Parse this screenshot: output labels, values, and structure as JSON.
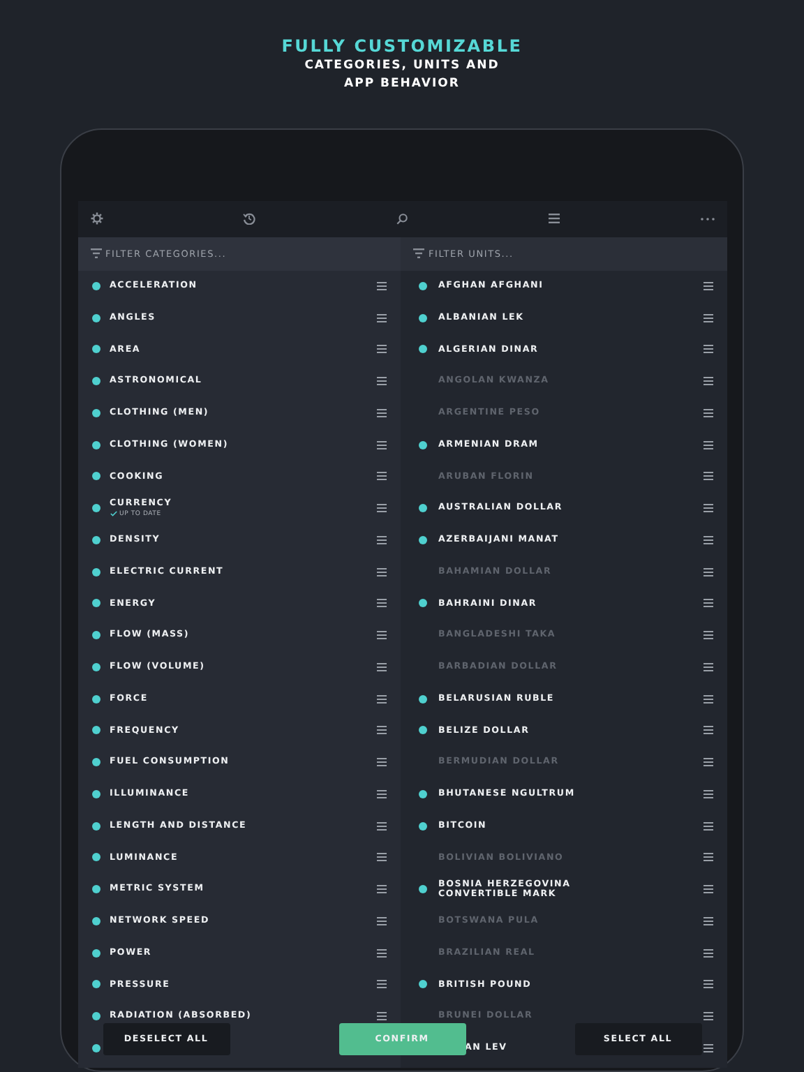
{
  "header": {
    "title": "FULLY CUSTOMIZABLE",
    "subtitle": "CATEGORIES, UNITS AND APP BEHAVIOR"
  },
  "categories": {
    "placeholder": "FILTER CATEGORIES...",
    "items": [
      {
        "label": "ACCELERATION",
        "selected": true
      },
      {
        "label": "ANGLES",
        "selected": true
      },
      {
        "label": "AREA",
        "selected": true
      },
      {
        "label": "ASTRONOMICAL",
        "selected": true
      },
      {
        "label": "CLOTHING (MEN)",
        "selected": true
      },
      {
        "label": "CLOTHING (WOMEN)",
        "selected": true
      },
      {
        "label": "COOKING",
        "selected": true
      },
      {
        "label": "CURRENCY",
        "status": "UP TO DATE",
        "selected": true
      },
      {
        "label": "DENSITY",
        "selected": true
      },
      {
        "label": "ELECTRIC CURRENT",
        "selected": true
      },
      {
        "label": "ENERGY",
        "selected": true
      },
      {
        "label": "FLOW (MASS)",
        "selected": true
      },
      {
        "label": "FLOW (VOLUME)",
        "selected": true
      },
      {
        "label": "FORCE",
        "selected": true
      },
      {
        "label": "FREQUENCY",
        "selected": true
      },
      {
        "label": "FUEL CONSUMPTION",
        "selected": true
      },
      {
        "label": "ILLUMINANCE",
        "selected": true
      },
      {
        "label": "LENGTH AND DISTANCE",
        "selected": true
      },
      {
        "label": "LUMINANCE",
        "selected": true
      },
      {
        "label": "METRIC SYSTEM",
        "selected": true
      },
      {
        "label": "NETWORK SPEED",
        "selected": true
      },
      {
        "label": "POWER",
        "selected": true
      },
      {
        "label": "PRESSURE",
        "selected": true
      },
      {
        "label": "RADIATION (ABSORBED)",
        "selected": true
      }
    ],
    "covered_row": {
      "selected": true
    }
  },
  "units": {
    "placeholder": "FILTER UNITS...",
    "items": [
      {
        "label": "AFGHAN AFGHANI",
        "selected": true
      },
      {
        "label": "ALBANIAN LEK",
        "selected": true
      },
      {
        "label": "ALGERIAN DINAR",
        "selected": true
      },
      {
        "label": "ANGOLAN KWANZA",
        "selected": false
      },
      {
        "label": "ARGENTINE PESO",
        "selected": false
      },
      {
        "label": "ARMENIAN DRAM",
        "selected": true
      },
      {
        "label": "ARUBAN FLORIN",
        "selected": false
      },
      {
        "label": "AUSTRALIAN DOLLAR",
        "selected": true
      },
      {
        "label": "AZERBAIJANI MANAT",
        "selected": true
      },
      {
        "label": "BAHAMIAN DOLLAR",
        "selected": false
      },
      {
        "label": "BAHRAINI DINAR",
        "selected": true
      },
      {
        "label": "BANGLADESHI TAKA",
        "selected": false
      },
      {
        "label": "BARBADIAN DOLLAR",
        "selected": false
      },
      {
        "label": "BELARUSIAN RUBLE",
        "selected": true
      },
      {
        "label": "BELIZE DOLLAR",
        "selected": true
      },
      {
        "label": "BERMUDIAN DOLLAR",
        "selected": false
      },
      {
        "label": "BHUTANESE NGULTRUM",
        "selected": true
      },
      {
        "label": "BITCOIN",
        "selected": true
      },
      {
        "label": "BOLIVIAN BOLIVIANO",
        "selected": false
      },
      {
        "label": "BOSNIA HERZEGOVINA CONVERTIBLE MARK",
        "selected": true
      },
      {
        "label": "BOTSWANA PULA",
        "selected": false
      },
      {
        "label": "BRAZILIAN REAL",
        "selected": false
      },
      {
        "label": "BRITISH POUND",
        "selected": true
      },
      {
        "label": "BRUNEI DOLLAR",
        "selected": false
      }
    ],
    "covered_row": {
      "label": "AN LEV",
      "selected": true
    }
  },
  "buttons": {
    "deselect": "DESELECT ALL",
    "confirm": "CONFIRM",
    "select": "SELECT ALL"
  }
}
